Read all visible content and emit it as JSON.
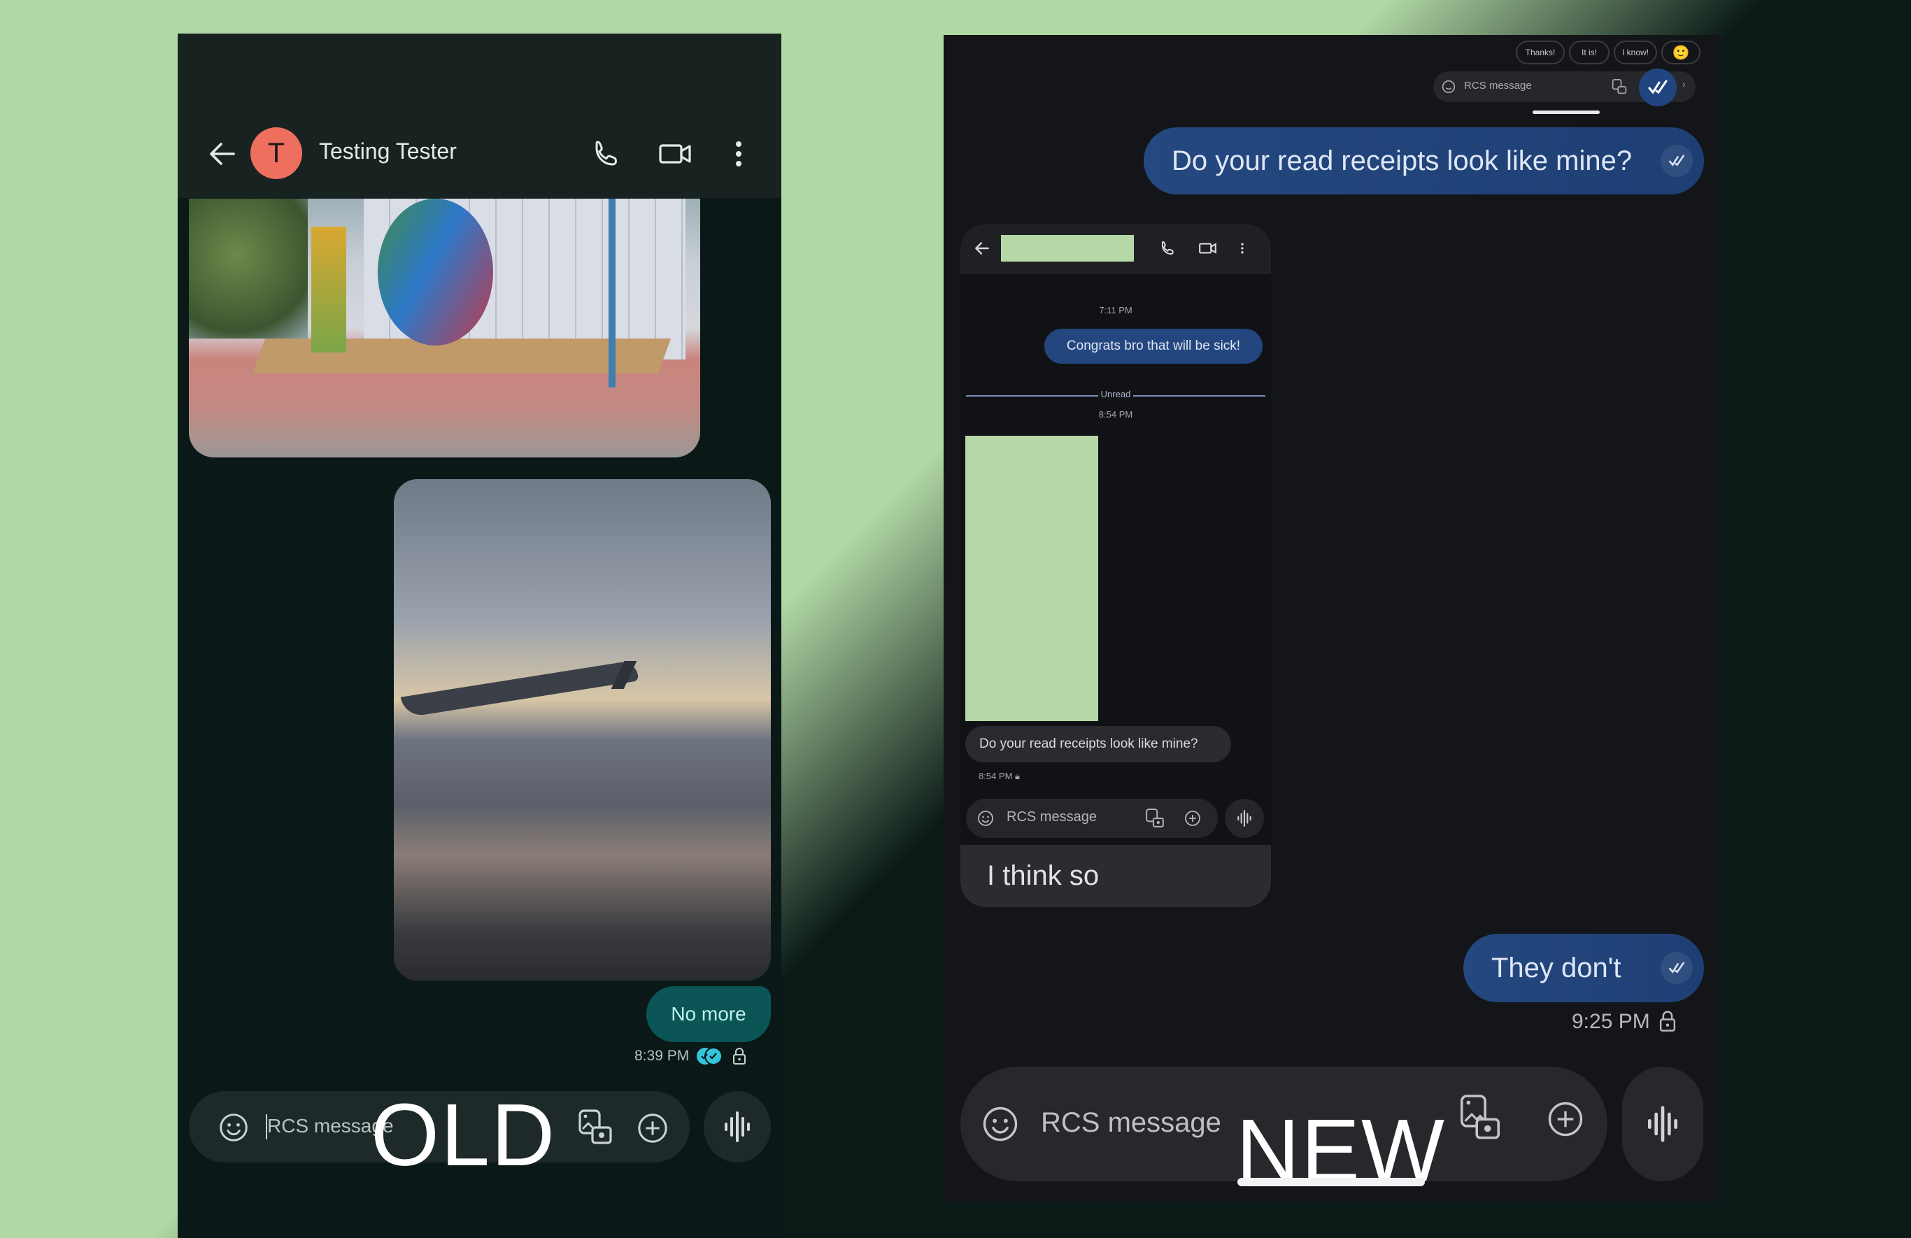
{
  "colors": {
    "bg_light": "#b1d8a5",
    "bg_dark": "#0b1a17",
    "old_panel_bg": "#0a1918",
    "old_accent_bubble": "#0b5556",
    "old_receipt": "#35c4dc",
    "new_panel_bg": "#141518",
    "new_accent_bubble": "#23467e",
    "redaction": "#b5d8a6"
  },
  "labels": {
    "old": "OLD",
    "new": "NEW"
  },
  "old": {
    "header": {
      "avatar_initial": "T",
      "contact_name": "Testing Tester",
      "icons": [
        "back-arrow-icon",
        "phone-icon",
        "video-icon",
        "more-vert-icon"
      ]
    },
    "messages": [
      {
        "type": "image",
        "direction": "received",
        "description": "Google I/O sign outdoor photo"
      },
      {
        "type": "image",
        "direction": "sent",
        "description": "Airplane wing above clouds at sunset"
      },
      {
        "type": "text",
        "direction": "sent",
        "text": "No more"
      }
    ],
    "status": {
      "time": "8:39 PM",
      "receipt": "read",
      "encrypted": true
    },
    "compose": {
      "placeholder": "RCS message"
    }
  },
  "new": {
    "suggestions": [
      "Thanks!",
      "It is!",
      "I know!",
      "🙂"
    ],
    "mini_compose": {
      "placeholder": "RCS message",
      "more": "›"
    },
    "messages": [
      {
        "type": "text",
        "direction": "sent",
        "text": "Do your read receipts look like mine?",
        "receipt": "read"
      },
      {
        "type": "text",
        "direction": "sent",
        "text": "They don't",
        "receipt": "read"
      }
    ],
    "embedded_screenshot": {
      "time_1": "7:11 PM",
      "sent_text": "Congrats bro that will be sick!",
      "unread_label": "Unread",
      "time_2": "8:54 PM",
      "received_text": "Do your read receipts look like mine?",
      "time_3": "8:54 PM",
      "compose_placeholder": "RCS message",
      "reply_text": "I think so"
    },
    "status": {
      "time": "9:25 PM",
      "encrypted": true
    },
    "compose": {
      "placeholder": "RCS message"
    }
  }
}
